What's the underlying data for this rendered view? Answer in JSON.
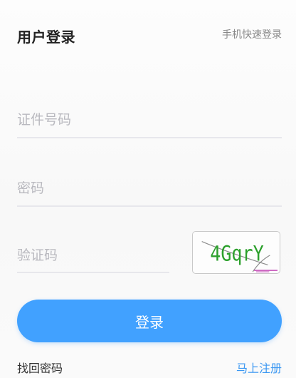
{
  "header": {
    "title": "用户登录",
    "quick_login": "手机快速登录"
  },
  "form": {
    "id_placeholder": "证件号码",
    "password_placeholder": "密码",
    "captcha_placeholder": "验证码",
    "captcha_text": "4GqrY",
    "login_label": "登录"
  },
  "footer": {
    "forgot_password": "找回密码",
    "register": "马上注册"
  },
  "colors": {
    "primary": "#41a1ff",
    "link": "#3a97f2",
    "captcha_text": "#2ca02c"
  }
}
